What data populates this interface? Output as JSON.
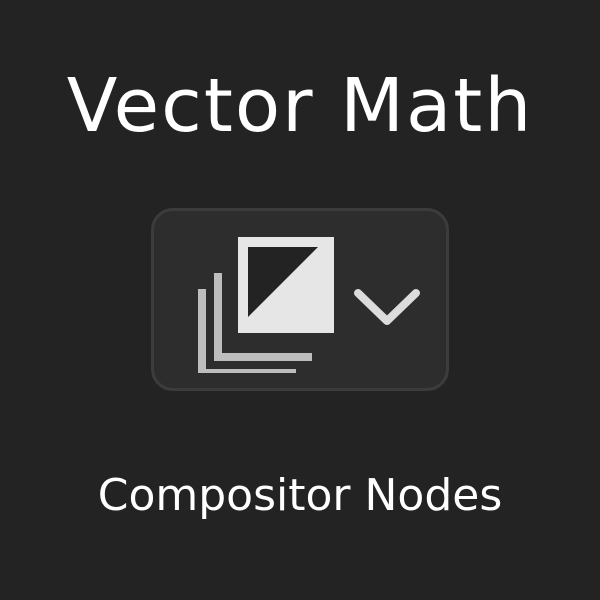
{
  "title": "Vector Math",
  "editor_type_button": {
    "icon": "image-editor-icon",
    "dropdown_icon": "chevron-down-icon"
  },
  "subtitle": "Compositor Nodes",
  "colors": {
    "background": "#232323",
    "button_background": "#2d2d2d",
    "button_border": "#3c3c3c",
    "icon_light": "#e6e6e6",
    "icon_dark": "#232323",
    "text": "#ffffff"
  }
}
